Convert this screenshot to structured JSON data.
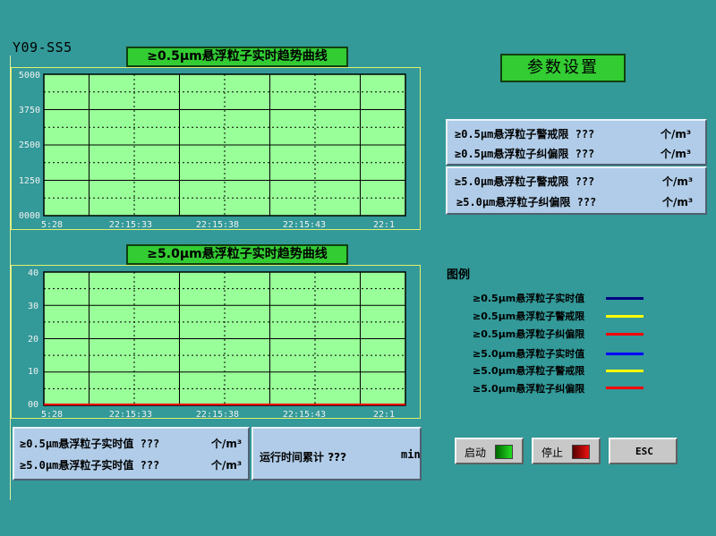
{
  "station_id": "Y09-SS5",
  "charts": [
    {
      "title": "≥0.5μm悬浮粒子实时趋势曲线",
      "y_ticks": [
        "5000",
        "3750",
        "2500",
        "1250",
        "0000"
      ],
      "x_ticks": [
        "5:28",
        "22:15:33",
        "22:15:38",
        "22:15:43",
        "22:1"
      ]
    },
    {
      "title": "≥5.0μm悬浮粒子实时趋势曲线",
      "y_ticks": [
        "40",
        "30",
        "20",
        "10",
        "00"
      ],
      "x_ticks": [
        "5:28",
        "22:15:33",
        "22:15:38",
        "22:15:43",
        "22:1"
      ]
    }
  ],
  "chart_data": [
    {
      "type": "line",
      "title": "≥0.5μm悬浮粒子实时趋势曲线",
      "categories": [
        "5:28",
        "22:15:33",
        "22:15:38",
        "22:15:43",
        "22:1"
      ],
      "ylim": [
        0,
        5000
      ],
      "grid": true,
      "series": []
    },
    {
      "type": "line",
      "title": "≥5.0μm悬浮粒子实时趋势曲线",
      "categories": [
        "5:28",
        "22:15:33",
        "22:15:38",
        "22:15:43",
        "22:1"
      ],
      "ylim": [
        0,
        40
      ],
      "grid": true,
      "series": [
        {
          "values": [
            0,
            0,
            0,
            0,
            0
          ],
          "color": "#ff0000"
        }
      ]
    }
  ],
  "params_button": "参数设置",
  "limits": {
    "p05": [
      {
        "label": "≥0.5μm悬浮粒子警戒限",
        "value": "???",
        "unit": "个/m³"
      },
      {
        "label": "≥0.5μm悬浮粒子纠偏限",
        "value": "???",
        "unit": "个/m³"
      }
    ],
    "p50": [
      {
        "label": "≥5.0μm悬浮粒子警戒限",
        "value": "???",
        "unit": "个/m³"
      },
      {
        "label": "≥5.0μm悬浮粒子纠偏限",
        "value": "???",
        "unit": "个/m³"
      }
    ]
  },
  "legend": {
    "title": "图例",
    "items": [
      {
        "label": "≥0.5μm悬浮粒子实时值",
        "color": "#000080"
      },
      {
        "label": "≥0.5μm悬浮粒子警戒限",
        "color": "#ffff00"
      },
      {
        "label": "≥0.5μm悬浮粒子纠偏限",
        "color": "#ff0000"
      },
      {
        "label": "≥5.0μm悬浮粒子实时值",
        "color": "#0000ff"
      },
      {
        "label": "≥5.0μm悬浮粒子警戒限",
        "color": "#ffff00"
      },
      {
        "label": "≥5.0μm悬浮粒子纠偏限",
        "color": "#ff0000"
      }
    ]
  },
  "realtime": [
    {
      "label": "≥0.5μm悬浮粒子实时值",
      "value": "???",
      "unit": "个/m³"
    },
    {
      "label": "≥5.0μm悬浮粒子实时值",
      "value": "???",
      "unit": "个/m³"
    }
  ],
  "runtime": {
    "label": "运行时间累计",
    "value": "???",
    "unit": "min"
  },
  "controls": {
    "start": {
      "label": "启动",
      "swatch_from": "#006600",
      "swatch_to": "#22dd22"
    },
    "stop": {
      "label": "停止",
      "swatch_from": "#550000",
      "swatch_to": "#ee1111"
    },
    "esc": {
      "label": "ESC"
    }
  }
}
